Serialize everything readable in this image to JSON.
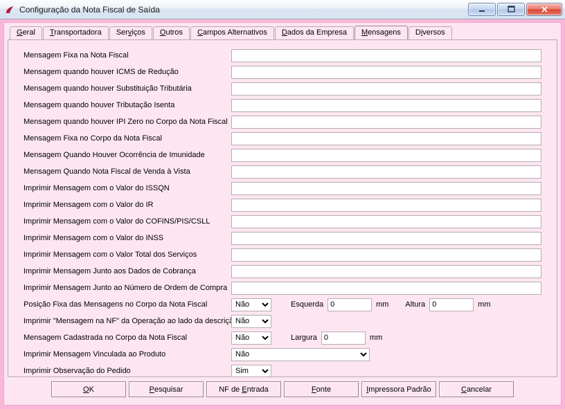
{
  "window": {
    "title": "Configuração da Nota Fiscal de Saída"
  },
  "tabs": [
    {
      "label_pre": "",
      "u": "G",
      "label_post": "eral"
    },
    {
      "label_pre": "",
      "u": "T",
      "label_post": "ransportadora"
    },
    {
      "label_pre": "Ser",
      "u": "v",
      "label_post": "iços"
    },
    {
      "label_pre": "",
      "u": "O",
      "label_post": "utros"
    },
    {
      "label_pre": "",
      "u": "C",
      "label_post": "ampos Alternativos"
    },
    {
      "label_pre": "",
      "u": "D",
      "label_post": "ados da Empresa"
    },
    {
      "label_pre": "",
      "u": "M",
      "label_post": "ensagens"
    },
    {
      "label_pre": "D",
      "u": "i",
      "label_post": "versos"
    }
  ],
  "active_tab_index": 6,
  "fields": {
    "msg_text": [
      {
        "label": "Mensagem Fixa na Nota Fiscal",
        "value": ""
      },
      {
        "label": "Mensagem quando houver ICMS de Redução",
        "value": ""
      },
      {
        "label": "Mensagem quando houver Substituição Tributária",
        "value": ""
      },
      {
        "label": "Mensagem quando houver Tributação Isenta",
        "value": ""
      },
      {
        "label": "Mensagem quando houver IPI Zero no Corpo da Nota Fiscal",
        "value": ""
      },
      {
        "label": "Mensagem Fixa no Corpo da Nota Fiscal",
        "value": ""
      },
      {
        "label": "Mensagem Quando Houver Ocorrência de Imunidade",
        "value": ""
      },
      {
        "label": "Mensagem Quando Nota Fiscal de Venda à Vista",
        "value": ""
      },
      {
        "label": "Imprimir Mensagem com o Valor do ISSQN",
        "value": ""
      },
      {
        "label": "Imprimir Mensagem com o Valor do IR",
        "value": ""
      },
      {
        "label": "Imprimir Mensagem com o Valor do COFINS/PIS/CSLL",
        "value": ""
      },
      {
        "label": "Imprimir Mensagem com o Valor do INSS",
        "value": ""
      },
      {
        "label": "Imprimir Mensagem com o Valor Total dos Serviços",
        "value": ""
      },
      {
        "label": "Imprimir Mensagem Junto aos Dados de Cobrança",
        "value": ""
      },
      {
        "label": "Imprimir Mensagem Junto ao Número de Ordem de Compra",
        "value": ""
      }
    ],
    "posicao_fixa": {
      "label": "Posição Fixa das Mensagens no Corpo da Nota Fiscal",
      "value": "Não",
      "esquerda_label": "Esquerda",
      "esquerda_value": "0",
      "esquerda_unit": "mm",
      "altura_label": "Altura",
      "altura_value": "0",
      "altura_unit": "mm"
    },
    "imprimir_msg_nf_oper": {
      "label": "Imprimir \"Mensagem na NF\" da Operação ao lado da descrição",
      "value": "Não"
    },
    "msg_cadastrada_corpo": {
      "label": "Mensagem Cadastrada no Corpo da Nota Fiscal",
      "value": "Não",
      "largura_label": "Largura",
      "largura_value": "0",
      "largura_unit": "mm"
    },
    "imprimir_msg_vinc_produto": {
      "label": "Imprimir Mensagem Vinculada ao Produto",
      "value": "Não"
    },
    "imprimir_obs_pedido": {
      "label": "Imprimir Observação do Pedido",
      "value": "Sim"
    }
  },
  "select_options": {
    "sim_nao": [
      "Sim",
      "Não"
    ]
  },
  "buttons": {
    "ok": {
      "pre": "",
      "u": "O",
      "post": "K"
    },
    "pesquisar": {
      "pre": "",
      "u": "P",
      "post": "esquisar"
    },
    "nf_entrada": {
      "pre": "NF de ",
      "u": "E",
      "post": "ntrada"
    },
    "fonte": {
      "pre": "",
      "u": "F",
      "post": "onte"
    },
    "impressora": {
      "pre": "",
      "u": "I",
      "post": "mpressora Padrão"
    },
    "cancelar": {
      "pre": "",
      "u": "C",
      "post": "ancelar"
    }
  }
}
